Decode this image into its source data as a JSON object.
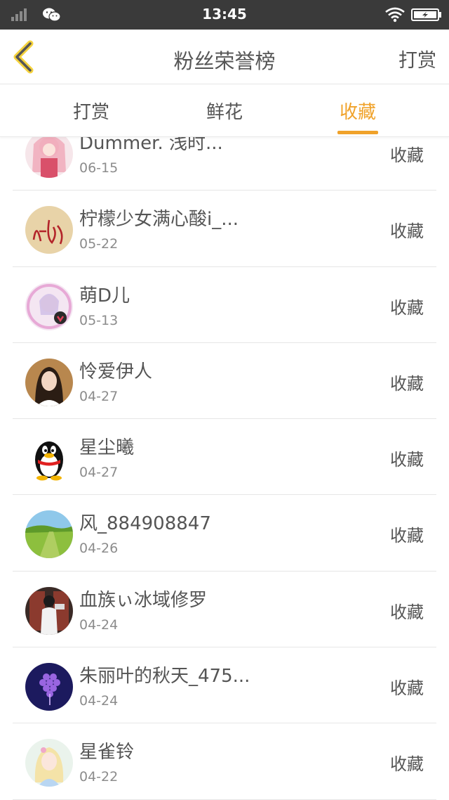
{
  "status_bar": {
    "time": "13:45"
  },
  "header": {
    "title": "粉丝荣誉榜",
    "action": "打赏"
  },
  "tabs": [
    {
      "label": "打赏",
      "active": false
    },
    {
      "label": "鲜花",
      "active": false
    },
    {
      "label": "收藏",
      "active": true
    }
  ],
  "accent_color": "#f0a22a",
  "list": [
    {
      "name": "Dummer.    浅时...",
      "date": "06-15",
      "action": "收藏",
      "avatar": "anime-girl-pink"
    },
    {
      "name": "柠檬少女满心酸i_...",
      "date": "05-22",
      "action": "收藏",
      "avatar": "handwriting-ta"
    },
    {
      "name": "萌D儿",
      "date": "05-13",
      "action": "收藏",
      "avatar": "anime-girl-frame"
    },
    {
      "name": "怜爱伊人",
      "date": "04-27",
      "action": "收藏",
      "avatar": "girl-portrait"
    },
    {
      "name": "星尘曦",
      "date": "04-27",
      "action": "收藏",
      "avatar": "qq-penguin"
    },
    {
      "name": "风_884908847",
      "date": "04-26",
      "action": "收藏",
      "avatar": "green-landscape"
    },
    {
      "name": "血族ぃ冰域修罗",
      "date": "04-24",
      "action": "收藏",
      "avatar": "person-doorway"
    },
    {
      "name": "朱丽叶的秋天_475...",
      "date": "04-24",
      "action": "收藏",
      "avatar": "purple-grapes"
    },
    {
      "name": "星雀铃",
      "date": "04-22",
      "action": "收藏",
      "avatar": "anime-girl-pastel"
    }
  ]
}
